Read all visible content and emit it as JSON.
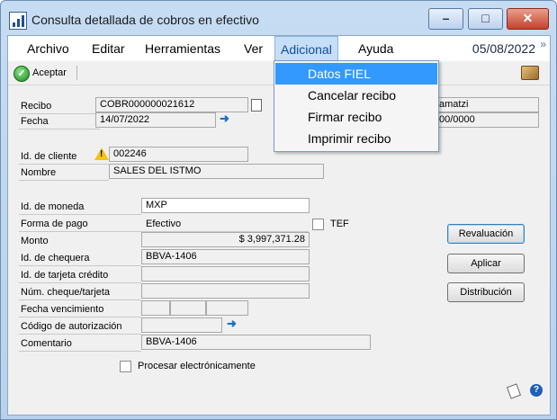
{
  "window": {
    "title": "Consulta detallada de cobros en efectivo",
    "minimize": "–",
    "maximize": "□",
    "close": "✕"
  },
  "menu": {
    "items": [
      "Archivo",
      "Editar",
      "Herramientas",
      "Ver",
      "Adicional",
      "Ayuda"
    ],
    "date": "05/08/2022",
    "more": "»"
  },
  "toolbar": {
    "accept_label": "Aceptar"
  },
  "form": {
    "recibo_label": "Recibo",
    "recibo_value": "COBR000000021612",
    "fecha_label": "Fecha",
    "fecha_value": "14/07/2022",
    "right_top_value": "amatzi",
    "right_date_value": "00/0000",
    "cliente_label": "Id. de cliente",
    "cliente_value": "002246",
    "nombre_label": "Nombre",
    "nombre_value": "SALES DEL ISTMO",
    "moneda_label": "Id. de moneda",
    "moneda_value": "MXP",
    "forma_label": "Forma de pago",
    "forma_value": "Efectivo",
    "tef_label": "TEF",
    "monto_label": "Monto",
    "monto_value": "$ 3,997,371.28",
    "chequera_label": "Id. de chequera",
    "chequera_value": "BBVA-1406",
    "tarjeta_label": "Id. de tarjeta crédito",
    "cheque_label": "Núm. cheque/tarjeta",
    "vencimiento_label": "Fecha vencimiento",
    "autorizacion_label": "Código de autorización",
    "comentario_label": "Comentario",
    "comentario_value": "BBVA-1406",
    "procesar_label": "Procesar electrónicamente"
  },
  "buttons": {
    "revaluacion": "Revaluación",
    "aplicar": "Aplicar",
    "distribucion": "Distribución"
  },
  "dropdown": {
    "items": [
      "Datos FIEL",
      "Cancelar recibo",
      "Firmar recibo",
      "Imprimir recibo"
    ]
  },
  "icons": {
    "accept": "check-icon",
    "help": "?"
  }
}
